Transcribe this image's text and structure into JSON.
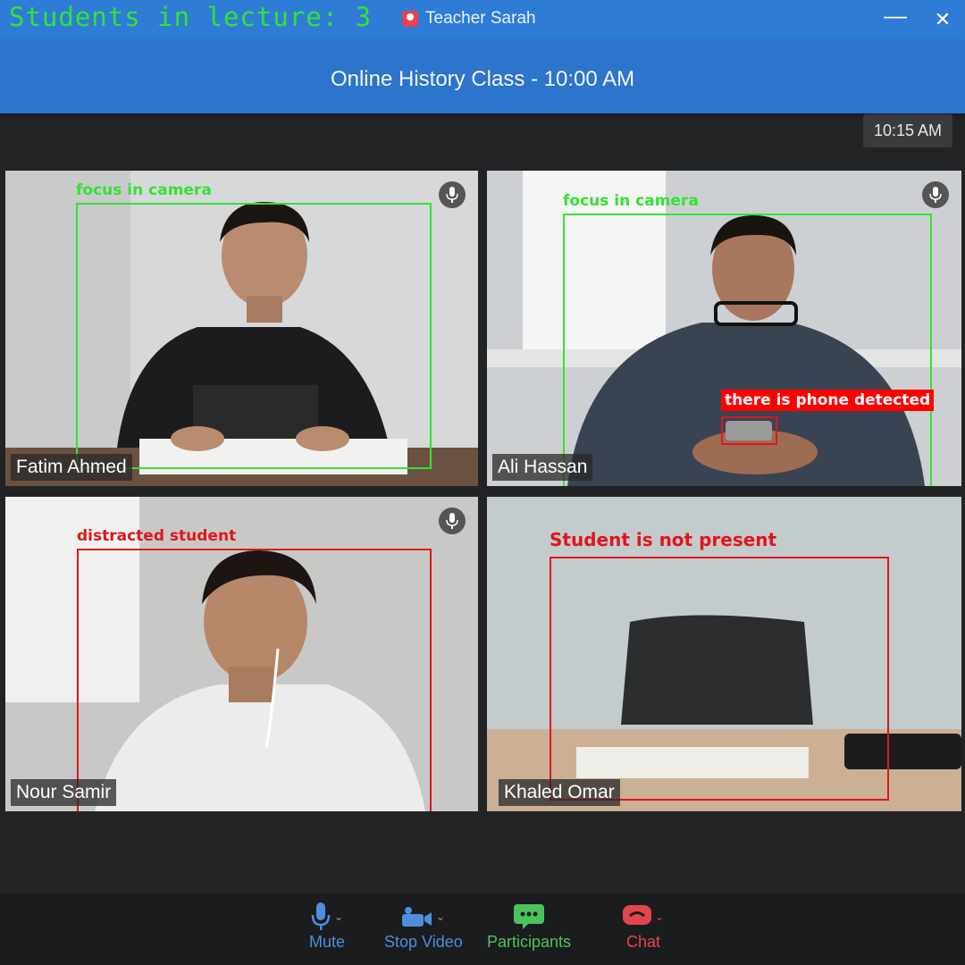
{
  "overlay": {
    "student_count": "Students  in  lecture:  3"
  },
  "window": {
    "host_label": "Teacher Sarah",
    "minimize": "—",
    "close": "✕"
  },
  "meeting": {
    "title": "Online History Class - 10:00 AM",
    "clock": "10:15 AM"
  },
  "tiles": [
    {
      "name": "Fatim  Ahmed",
      "status": "focus  in  camera",
      "status_color": "#33e233",
      "mic": "mic-icon"
    },
    {
      "name": "Ali Hassan",
      "status": "focus  in  camera",
      "status_color": "#33e233",
      "phone_alert": "there  is  phone  detected",
      "mic": "mic-icon"
    },
    {
      "name": "Nour Samir",
      "status": "distracted student",
      "status_color": "#e0161c",
      "mic": "mic-icon"
    },
    {
      "name": "Khaled Omar",
      "status": "Student is not present",
      "status_color": "#e0161c"
    }
  ],
  "toolbar": {
    "mute": "Mute",
    "stop_video": "Stop Video",
    "participants": "Participants",
    "chat": "Chat"
  },
  "colors": {
    "accent": "#2d74cc",
    "detect_ok": "#33e233",
    "detect_alert": "#e0161c",
    "participants_green": "#4cc35a",
    "chat_red": "#e0474c"
  }
}
